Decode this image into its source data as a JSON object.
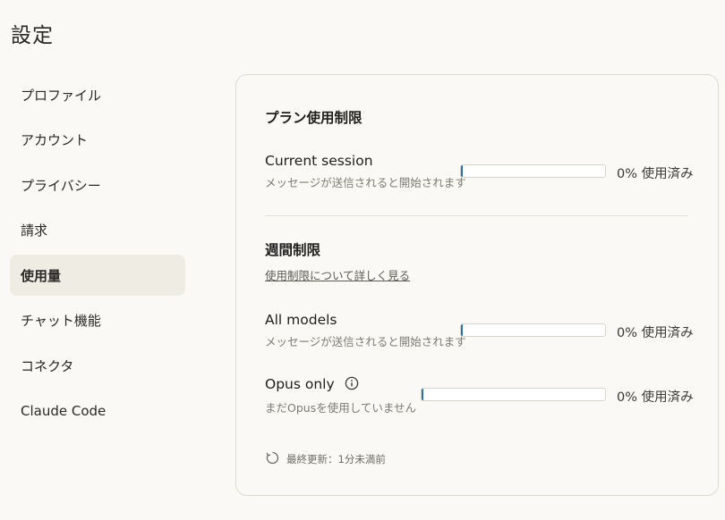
{
  "page": {
    "title": "設定"
  },
  "sidebar": {
    "items": [
      {
        "label": "プロファイル"
      },
      {
        "label": "アカウント"
      },
      {
        "label": "プライバシー"
      },
      {
        "label": "請求"
      },
      {
        "label": "使用量",
        "active": true
      },
      {
        "label": "チャット機能"
      },
      {
        "label": "コネクタ"
      },
      {
        "label": "Claude Code"
      }
    ]
  },
  "panel": {
    "title": "プラン使用制限",
    "current_session": {
      "label": "Current session",
      "sub": "メッセージが送信されると開始されます",
      "usage_percent": 0,
      "usage_text": "0% 使用済み"
    },
    "weekly": {
      "title": "週間制限",
      "link": "使用制限について詳しく見る",
      "all_models": {
        "label": "All models",
        "sub": "メッセージが送信されると開始されます",
        "usage_percent": 0,
        "usage_text": "0% 使用済み"
      },
      "opus_only": {
        "label": "Opus only",
        "sub": "まだOpusを使用していません",
        "usage_percent": 0,
        "usage_text": "0% 使用済み"
      }
    },
    "last_updated": "最終更新：1分未満前"
  },
  "colors": {
    "accent": "#2f6fb0",
    "active_bg": "#efece4",
    "background": "#faf9f5"
  }
}
